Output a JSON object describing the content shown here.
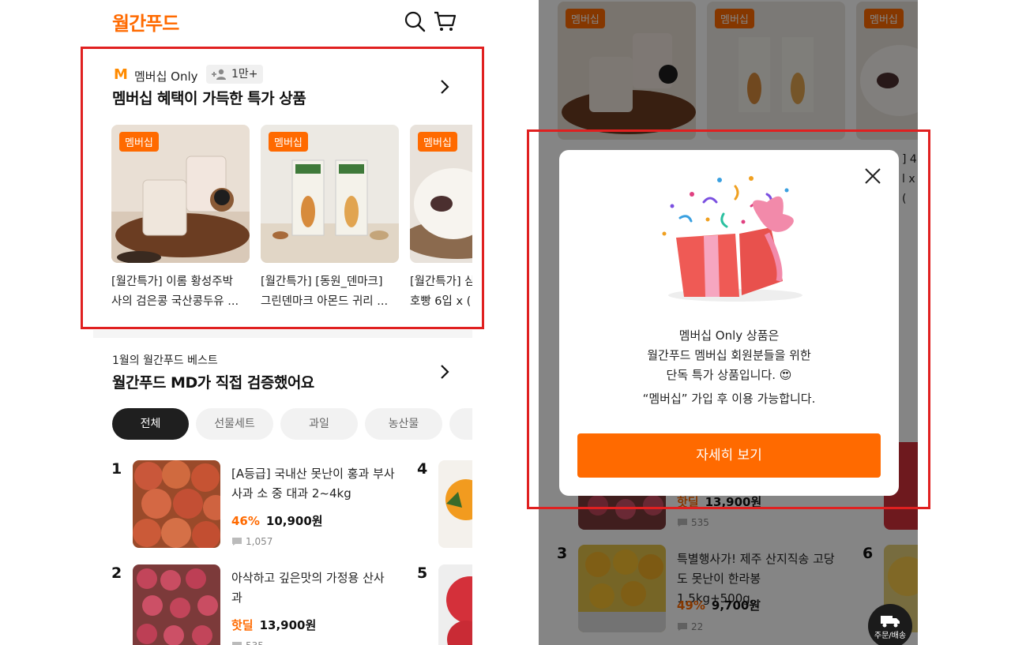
{
  "app": {
    "logo": "월간푸드"
  },
  "membership": {
    "badge": "M",
    "only_label": "멤버십 Only",
    "member_count": "1만+",
    "title": "멤버십 혜택이 가득한 특가 상품",
    "products": [
      {
        "tag": "멤버십",
        "line1": "[월간특가] 이롬 황성주박",
        "line2": "사의 검은콩 국산콩두유 ..."
      },
      {
        "tag": "멤버십",
        "line1": "[월간특가] [동원_덴마크]",
        "line2": "그린덴마크 아몬드 귀리 ..."
      },
      {
        "tag": "멤버십",
        "line1": "[월간특가] 삼",
        "line2": "호빵 6입 x ("
      }
    ]
  },
  "best": {
    "subtitle": "1월의 월간푸드 베스트",
    "title": "월간푸드 MD가 직접 검증했어요",
    "chips": [
      "전체",
      "선물세트",
      "과일",
      "농산물"
    ],
    "items": [
      {
        "rank": "1",
        "line1": "[A등급] 국내산 못난이 홍과 부사",
        "line2": "사과 소 중 대과 2~4kg",
        "discount": "46%",
        "price": "10,900원",
        "reviews": "1,057"
      },
      {
        "rank": "2",
        "line1": "아삭하고 깊은맛의 가정용 산사",
        "line2": "과",
        "discount": "핫딜",
        "price": "13,900원",
        "reviews": "535"
      }
    ],
    "side_ranks": [
      "4",
      "5"
    ]
  },
  "right_bg": {
    "tags": [
      "멤버십",
      "멤버십",
      "멤버십"
    ],
    "item2": {
      "discount": "핫딜",
      "price": "13,900원",
      "reviews": "535"
    },
    "item3": {
      "rank": "3",
      "line1": "특별행사가! 제주 산지직송 고당",
      "line2": "도 못난이 한라봉 1.5kg+500g...",
      "discount": "49%",
      "price": "9,700원",
      "reviews": "22"
    },
    "side_rank": "6",
    "fab_label": "주문/배송",
    "peek1": "] 4",
    "peek2": "l x ("
  },
  "modal": {
    "line1": "멤버십 Only 상품은",
    "line2": "월간푸드 멤버십 회원분들을 위한",
    "line3": "단독 특가 상품입니다. 😍",
    "line4": "“멤버십” 가입 후 이용 가능합니다.",
    "button": "자세히 보기"
  },
  "colors": {
    "accent": "#ff6a00",
    "highlight": "#e02020"
  }
}
